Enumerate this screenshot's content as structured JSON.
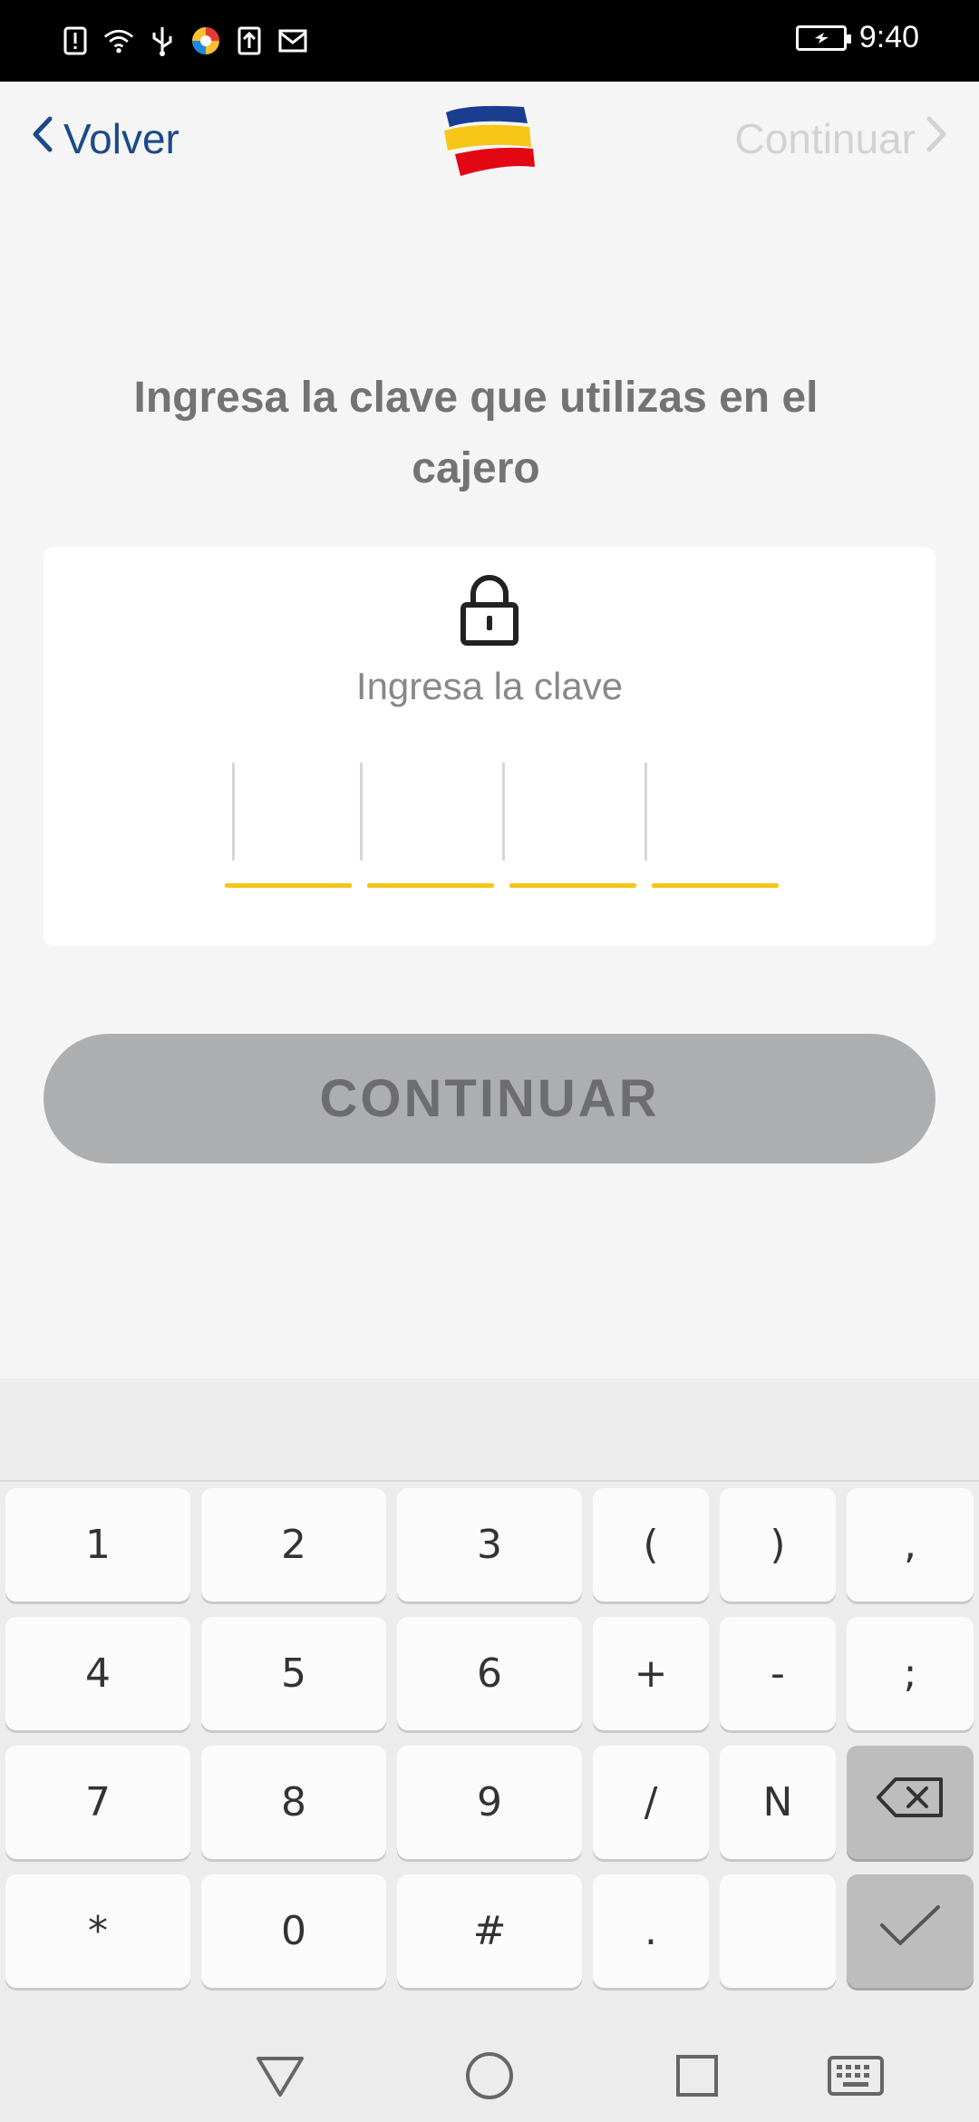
{
  "status_bar": {
    "time": "9:40",
    "icons": [
      "alert-icon",
      "wifi-icon",
      "usb-icon",
      "app-icon",
      "upload-icon",
      "gmail-icon"
    ]
  },
  "header": {
    "back_label": "Volver",
    "continue_label": "Continuar",
    "logo_colors": [
      "#1a3d8f",
      "#f5c518",
      "#e30613"
    ]
  },
  "main": {
    "title": "Ingresa la clave que utilizas en el cajero",
    "card_label": "Ingresa la clave",
    "pin_fields": [
      "",
      "",
      "",
      ""
    ],
    "continue_button": "CONTINUAR"
  },
  "colors": {
    "accent_blue": "#1a4a8a",
    "pin_underline": "#f5c518",
    "button_disabled": "#adaeb0"
  },
  "keyboard": {
    "rows": [
      [
        "1",
        "2",
        "3",
        "(",
        ")",
        ","
      ],
      [
        "4",
        "5",
        "6",
        "+",
        "-",
        ";"
      ],
      [
        "7",
        "8",
        "9",
        "/",
        "N",
        "backspace"
      ],
      [
        "*",
        "0",
        "#",
        ".",
        "",
        "done"
      ]
    ]
  },
  "navbar": {
    "buttons": [
      "back-triangle-icon",
      "home-circle-icon",
      "recents-square-icon",
      "keyboard-icon"
    ]
  }
}
